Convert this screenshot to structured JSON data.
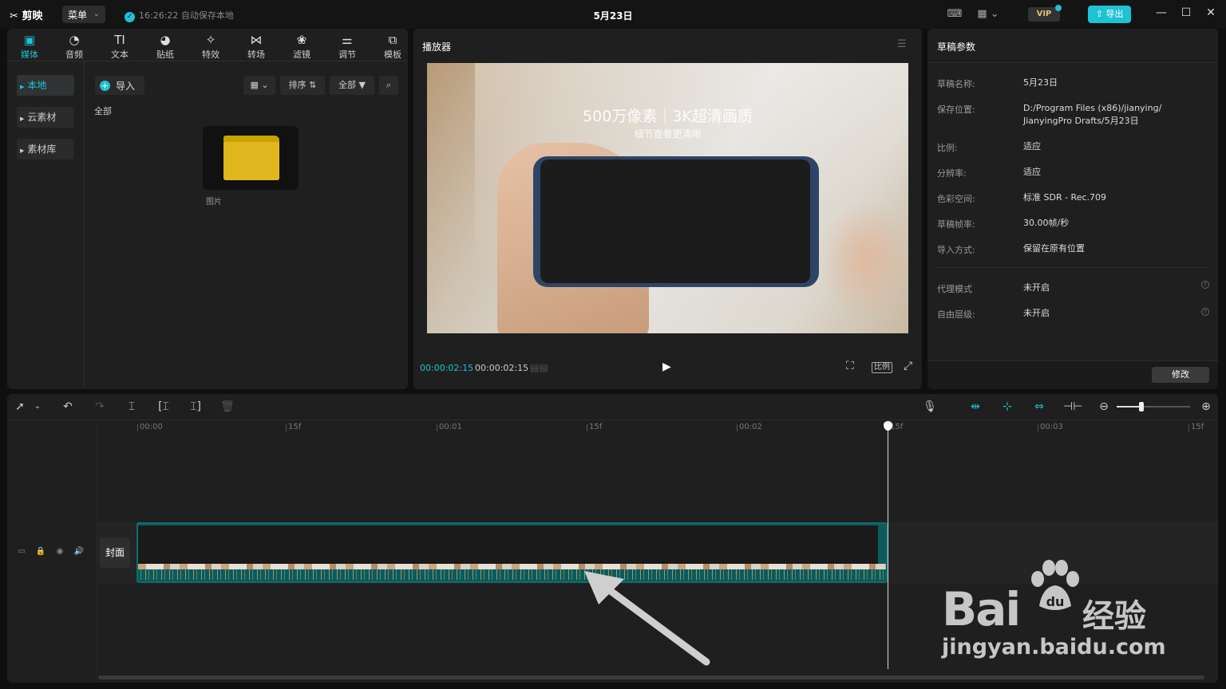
{
  "titlebar": {
    "logo": "剪映",
    "menu_label": "菜单",
    "save_status": "16:26:22 自动保存本地",
    "doc_title": "5月23日",
    "vip": "VIP",
    "export_label": "导出"
  },
  "media": {
    "tabs": [
      {
        "label": "媒体",
        "icon": "media-icon"
      },
      {
        "label": "音频",
        "icon": "audio-icon"
      },
      {
        "label": "文本",
        "icon": "text-icon"
      },
      {
        "label": "贴纸",
        "icon": "sticker-icon"
      },
      {
        "label": "特效",
        "icon": "effects-icon"
      },
      {
        "label": "转场",
        "icon": "transition-icon"
      },
      {
        "label": "滤镜",
        "icon": "filter-icon"
      },
      {
        "label": "调节",
        "icon": "adjust-icon"
      },
      {
        "label": "模板",
        "icon": "template-icon"
      }
    ],
    "side": [
      "本地",
      "云素材",
      "素材库"
    ],
    "import_label": "导入",
    "sort_label": "排序",
    "all_filter_label": "全部",
    "all_label": "全部",
    "folder_label": "图片"
  },
  "player": {
    "title": "播放器",
    "headline": "500万像素｜3K超清画质",
    "subline": "细节查看更清晰",
    "time_current": "00:00:02:15",
    "time_total": "00:00:02:15",
    "ratio_label": "比例"
  },
  "props": {
    "title": "草稿参数",
    "rows": [
      {
        "key": "草稿名称:",
        "value": "5月23日"
      },
      {
        "key": "保存位置:",
        "value": "D:/Program Files (x86)/jianying/ JianyingPro Drafts/5月23日"
      },
      {
        "key": "比例:",
        "value": "适应"
      },
      {
        "key": "分辨率:",
        "value": "适应"
      },
      {
        "key": "色彩空间:",
        "value": "标准 SDR - Rec.709"
      },
      {
        "key": "草稿帧率:",
        "value": "30.00帧/秒"
      },
      {
        "key": "导入方式:",
        "value": "保留在原有位置"
      }
    ],
    "extra_rows": [
      {
        "key": "代理模式",
        "value": "未开启"
      },
      {
        "key": "自由层级:",
        "value": "未开启"
      }
    ],
    "modify_label": "修改"
  },
  "timeline": {
    "ticks": [
      "00:00",
      "15f",
      "00:01",
      "15f",
      "00:02",
      "15f",
      "00:03",
      "15f"
    ],
    "cover_label": "封面"
  },
  "watermark": {
    "brand": "Bai",
    "brand2": "经验",
    "url": "jingyan.baidu.com"
  },
  "colors": {
    "accent": "#1fc2d2",
    "clip": "#0d5a5a"
  }
}
